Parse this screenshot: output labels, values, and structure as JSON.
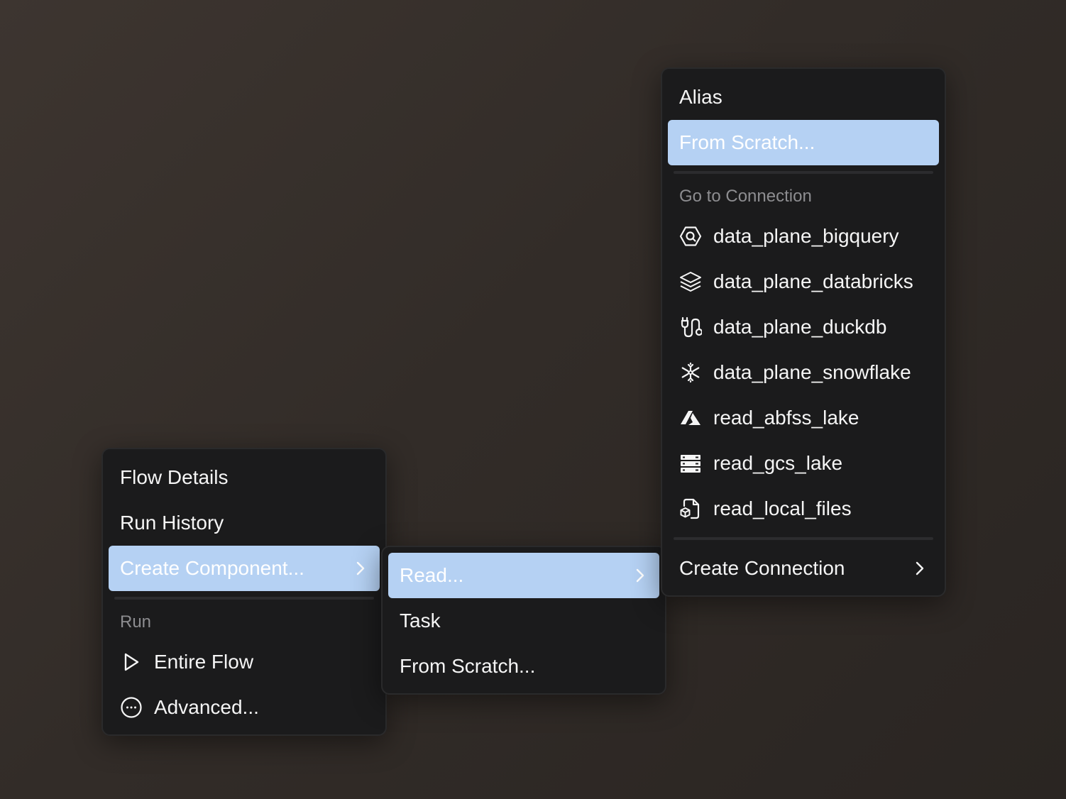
{
  "main_menu": {
    "items": [
      {
        "label": "Flow Details"
      },
      {
        "label": "Run History"
      },
      {
        "label": "Create Component..."
      }
    ],
    "run_section": {
      "header": "Run",
      "items": [
        {
          "label": "Entire Flow",
          "icon": "play-icon"
        },
        {
          "label": "Advanced...",
          "icon": "more-circle-icon"
        }
      ]
    }
  },
  "create_component_menu": {
    "items": [
      {
        "label": "Read..."
      },
      {
        "label": "Task"
      },
      {
        "label": "From Scratch..."
      }
    ]
  },
  "read_menu": {
    "items": [
      {
        "label": "Alias"
      },
      {
        "label": "From Scratch..."
      }
    ],
    "connection_section": {
      "header": "Go to Connection",
      "items": [
        {
          "label": "data_plane_bigquery",
          "icon": "bigquery-icon"
        },
        {
          "label": "data_plane_databricks",
          "icon": "databricks-icon"
        },
        {
          "label": "data_plane_duckdb",
          "icon": "duckdb-icon"
        },
        {
          "label": "data_plane_snowflake",
          "icon": "snowflake-icon"
        },
        {
          "label": "read_abfss_lake",
          "icon": "azure-icon"
        },
        {
          "label": "read_gcs_lake",
          "icon": "gcs-icon"
        },
        {
          "label": "read_local_files",
          "icon": "local-files-icon"
        }
      ]
    },
    "create_connection": {
      "label": "Create Connection"
    }
  },
  "colors": {
    "active_highlight": "#b5d1f3",
    "menu_background": "#1b1b1c",
    "section_header": "#8d8d90",
    "text": "#f5f5f5"
  }
}
